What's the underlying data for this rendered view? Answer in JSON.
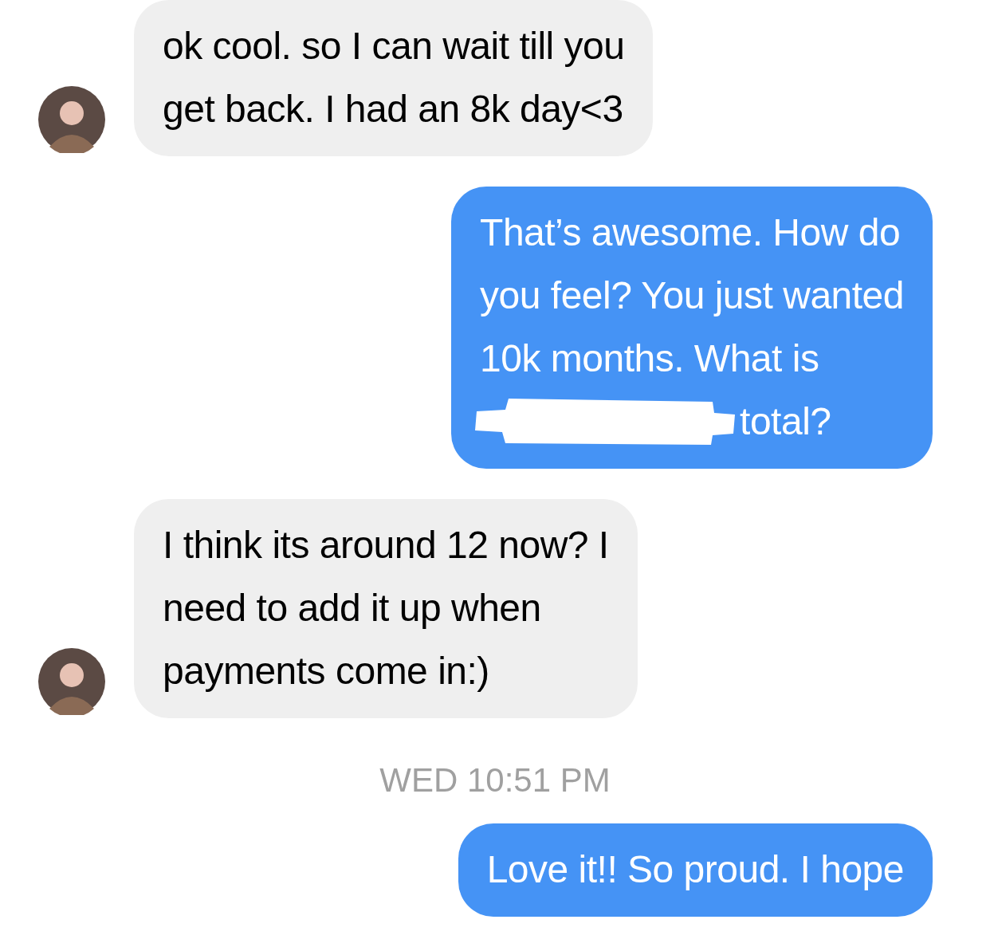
{
  "messages": [
    {
      "kind": "received",
      "avatar": true,
      "lines": [
        "ok cool. so I can wait till you",
        "get back. I had an 8k day<3"
      ]
    },
    {
      "kind": "sent",
      "lines": [
        "That’s awesome. How do",
        "you feel? You just wanted",
        "10k months. What is",
        "total?"
      ],
      "redacted_last_line": true
    },
    {
      "kind": "received",
      "avatar": true,
      "lines": [
        "I think its around 12 now? I",
        "need to add it up when",
        "payments come in:)"
      ]
    },
    {
      "kind": "timestamp",
      "text": "WED 10:51 PM"
    },
    {
      "kind": "sent",
      "lines": [
        "Love it!! So proud. I hope"
      ]
    }
  ]
}
